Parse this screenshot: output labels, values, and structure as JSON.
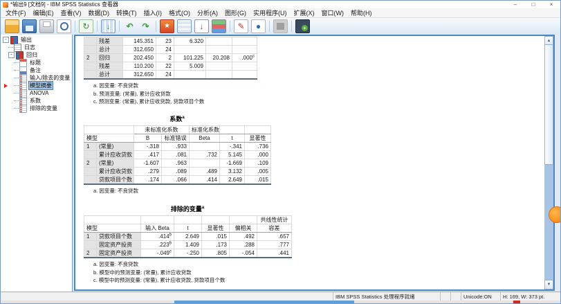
{
  "titlebar": {
    "title": "*输出9 [文档9] - IBM SPSS Statistics 查看器",
    "controls": {
      "minimize": "–",
      "maximize": "□",
      "close": "×"
    }
  },
  "menubar": {
    "items": [
      "文件(F)",
      "编辑(E)",
      "查看(V)",
      "数据(D)",
      "转换(T)",
      "插入(I)",
      "格式(O)",
      "分析(A)",
      "图形(G)",
      "实用程序(U)",
      "扩展(X)",
      "窗口(W)",
      "帮助(H)"
    ]
  },
  "toolbar": {
    "icons": [
      "open-icon",
      "save-icon",
      "print-icon",
      "print-preview-icon",
      "separator",
      "dialog-recall-icon",
      "separator",
      "goto-data-icon",
      "separator",
      "undo-icon",
      "redo-icon",
      "separator",
      "goto-case-icon",
      "goto-variable-icon",
      "variables-icon",
      "use-variable-sets-icon",
      "separator",
      "edit-output-icon",
      "export-icon",
      "separator",
      "window-inactive-icon",
      "separator",
      "designate-window-icon"
    ]
  },
  "outline": {
    "items": [
      {
        "id": "output",
        "label": "输出",
        "level": 0,
        "icon": "t-book",
        "expand": true
      },
      {
        "id": "log",
        "label": "日志",
        "level": 1,
        "icon": "t-log"
      },
      {
        "id": "regression",
        "label": "回归",
        "level": 1,
        "icon": "t-reg",
        "expand": true
      },
      {
        "id": "title",
        "label": "标题",
        "level": 2,
        "icon": "t-title"
      },
      {
        "id": "notes",
        "label": "备注",
        "level": 2,
        "icon": "t-notes"
      },
      {
        "id": "variables-entered-removed",
        "label": "输入/除去的变量",
        "level": 2,
        "icon": "t-table"
      },
      {
        "id": "model-summary",
        "label": "模型摘要",
        "level": 2,
        "icon": "t-table",
        "selected": true,
        "marker": true
      },
      {
        "id": "anova",
        "label": "ANOVA",
        "level": 2,
        "icon": "t-table"
      },
      {
        "id": "coefficients",
        "label": "系数",
        "level": 2,
        "icon": "t-table"
      },
      {
        "id": "excluded-variables",
        "label": "排除的变量",
        "level": 2,
        "icon": "t-table"
      }
    ]
  },
  "output": {
    "anova_tail": {
      "rows": [
        {
          "model": "",
          "label": "残差",
          "ss": "145.351",
          "df": "23",
          "ms": "6.320",
          "f": "",
          "sig": "",
          "sig_sup": ""
        },
        {
          "model": "",
          "label": "总计",
          "ss": "312.650",
          "df": "24",
          "ms": "",
          "f": "",
          "sig": "",
          "sig_sup": ""
        },
        {
          "model": "2",
          "label": "回归",
          "ss": "202.450",
          "df": "2",
          "ms": "101.225",
          "f": "20.208",
          "sig": ".000",
          "sig_sup": "c"
        },
        {
          "model": "",
          "label": "残差",
          "ss": "110.200",
          "df": "22",
          "ms": "5.009",
          "f": "",
          "sig": "",
          "sig_sup": ""
        },
        {
          "model": "",
          "label": "总计",
          "ss": "312.650",
          "df": "24",
          "ms": "",
          "f": "",
          "sig": "",
          "sig_sup": ""
        }
      ],
      "footnotes": [
        "a. 因变量: 不良贷款",
        "b. 预测变量: (常量), 累计应收贷款",
        "c. 预测变量: (常量), 累计应收贷款, 贷款项目个数"
      ]
    },
    "coefficients": {
      "title": "系数",
      "title_sup": "a",
      "headers": {
        "model": "模型",
        "unstandardized": "未标准化系数",
        "standardized": "标准化系数",
        "b": "B",
        "std_error": "标准错误",
        "beta": "Beta",
        "t": "t",
        "sig": "显著性"
      },
      "rows": [
        {
          "model": "1",
          "label": "(常量)",
          "b": "-.318",
          "se": ".933",
          "beta": "",
          "t": "-.341",
          "sig": ".736"
        },
        {
          "model": "",
          "label": "累计应收贷款",
          "b": ".417",
          "se": ".081",
          "beta": ".732",
          "t": "5.145",
          "sig": ".000"
        },
        {
          "model": "2",
          "label": "(常量)",
          "b": "-1.607",
          "se": ".963",
          "beta": "",
          "t": "-1.669",
          "sig": ".109"
        },
        {
          "model": "",
          "label": "累计应收贷款",
          "b": ".279",
          "se": ".089",
          "beta": ".489",
          "t": "3.132",
          "sig": ".005"
        },
        {
          "model": "",
          "label": "贷款项目个数",
          "b": ".174",
          "se": ".066",
          "beta": ".414",
          "t": "2.649",
          "sig": ".015"
        }
      ],
      "footnotes": [
        "a. 因变量: 不良贷款"
      ]
    },
    "excluded_variables": {
      "title": "排除的变量",
      "title_sup": "a",
      "headers": {
        "model": "模型",
        "beta_in": "输入 Beta",
        "t": "t",
        "sig": "显著性",
        "partial_correlation": "偏相关",
        "collinearity": "共线性统计",
        "tolerance": "容差"
      },
      "rows": [
        {
          "model": "1",
          "label": "贷款项目个数",
          "beta_in": ".414",
          "beta_sup": "b",
          "t": "2.649",
          "sig": ".015",
          "partial": ".492",
          "tolerance": ".657"
        },
        {
          "model": "",
          "label": "固定资产投资",
          "beta_in": ".223",
          "beta_sup": "b",
          "t": "1.409",
          "sig": ".173",
          "partial": ".288",
          "tolerance": ".777"
        },
        {
          "model": "2",
          "label": "固定资产投资",
          "beta_in": "-.049",
          "beta_sup": "c",
          "t": "-.250",
          "sig": ".805",
          "partial": "-.054",
          "tolerance": ".441"
        }
      ],
      "footnotes": [
        "a. 因变量: 不良贷款",
        "b. 模型中的预测变量: (常量), 累计应收贷款",
        "c. 模型中的预测变量: (常量), 累计应收贷款, 贷款项目个数"
      ]
    }
  },
  "statusbar": {
    "processor": "IBM SPSS Statistics 处理程序就绪",
    "unicode": "Unicode:ON",
    "dimensions": "H: 169, W: 373 pt."
  }
}
